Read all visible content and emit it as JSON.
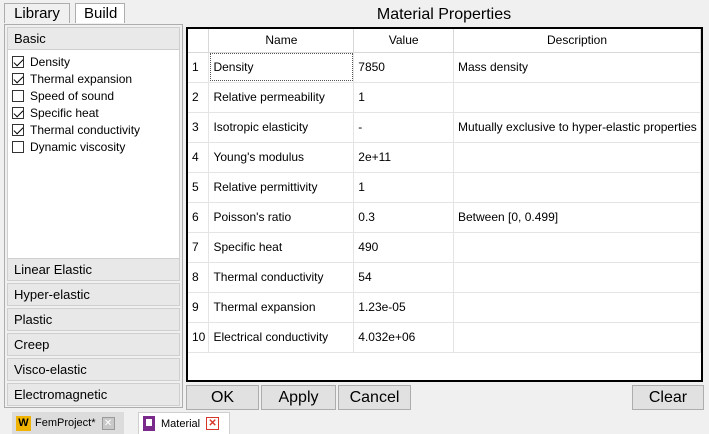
{
  "left_tabs": [
    "Library",
    "Build"
  ],
  "sections": {
    "basic": "Basic",
    "others": [
      "Linear Elastic",
      "Hyper-elastic",
      "Plastic",
      "Creep",
      "Visco-elastic",
      "Electromagnetic"
    ]
  },
  "basic_items": [
    {
      "label": "Density",
      "checked": true
    },
    {
      "label": "Thermal expansion",
      "checked": true
    },
    {
      "label": "Speed of sound",
      "checked": false
    },
    {
      "label": "Specific heat",
      "checked": true
    },
    {
      "label": "Thermal conductivity",
      "checked": true
    },
    {
      "label": "Dynamic viscosity",
      "checked": false
    }
  ],
  "title": "Material Properties",
  "table": {
    "headers": [
      "Name",
      "Value",
      "Description"
    ],
    "rows": [
      [
        "1",
        "Density",
        "7850",
        "Mass density"
      ],
      [
        "2",
        "Relative permeability",
        "1",
        ""
      ],
      [
        "3",
        "Isotropic elasticity",
        "-",
        "Mutually exclusive to hyper-elastic properties"
      ],
      [
        "4",
        "Young's modulus",
        "2e+11",
        ""
      ],
      [
        "5",
        "Relative permittivity",
        "1",
        ""
      ],
      [
        "6",
        "Poisson's ratio",
        "0.3",
        "Between [0, 0.499]"
      ],
      [
        "7",
        "Specific heat",
        "490",
        ""
      ],
      [
        "8",
        "Thermal conductivity",
        "54",
        ""
      ],
      [
        "9",
        "Thermal expansion",
        "1.23e-05",
        ""
      ],
      [
        "10",
        "Electrical conductivity",
        "4.032e+06",
        ""
      ]
    ]
  },
  "buttons": {
    "ok": "OK",
    "apply": "Apply",
    "cancel": "Cancel",
    "clear": "Clear"
  },
  "bottom_tabs": [
    {
      "label": "FemProject*",
      "icon": "W"
    },
    {
      "label": "Material"
    }
  ]
}
